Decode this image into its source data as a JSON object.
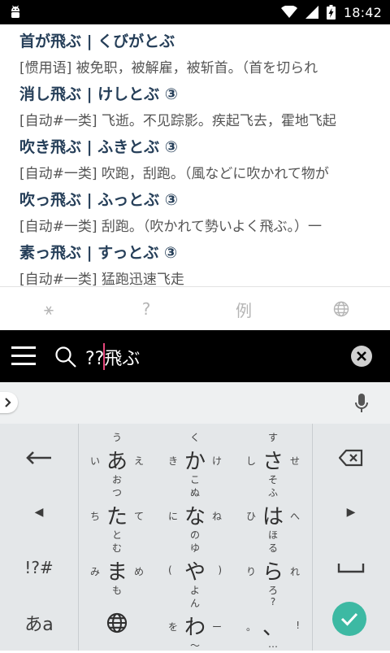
{
  "status_bar": {
    "time": "18:42"
  },
  "results": [
    {
      "word": "首が飛ぶ | くびがとぶ",
      "def": "[惯用语] 被免职，被解雇，被斩首。（首を切られ"
    },
    {
      "word": "消し飛ぶ | けしとぶ ③",
      "def": "[自动#一类] 飞逝。不见踪影。疾起飞去，霍地飞起"
    },
    {
      "word": "吹き飛ぶ | ふきとぶ ③",
      "def": "[自动#一类] 吹跑，刮跑。（風などに吹かれて物が"
    },
    {
      "word": "吹っ飛ぶ | ふっとぶ ③",
      "def": "[自动#一类] 刮跑。（吹かれて勢いよく飛ぶ。）一"
    },
    {
      "word": "素っ飛ぶ | すっとぶ ③",
      "def": "[自动#一类] 猛跑迅速飞走"
    }
  ],
  "tabs": [
    {
      "label": "⚹",
      "icon": "asterisk-icon"
    },
    {
      "label": "?",
      "icon": "question-icon"
    },
    {
      "label": "例",
      "icon": "example-icon"
    },
    {
      "label": "",
      "icon": "globe-icon"
    }
  ],
  "search": {
    "query": "??飛ぶ"
  },
  "keyboard": {
    "left_keys": [
      "⟵",
      "◀",
      "!?#",
      "あa"
    ],
    "right_keys": [
      "⌫",
      "▶",
      "⎵",
      "✓"
    ],
    "kana": [
      {
        "c": "あ",
        "u": "う",
        "d": "お",
        "l": "い",
        "r": "え"
      },
      {
        "c": "か",
        "u": "く",
        "d": "こ",
        "l": "き",
        "r": "け"
      },
      {
        "c": "さ",
        "u": "す",
        "d": "そ",
        "l": "し",
        "r": "せ"
      },
      {
        "c": "た",
        "u": "つ",
        "d": "と",
        "l": "ち",
        "r": "て"
      },
      {
        "c": "な",
        "u": "ぬ",
        "d": "の",
        "l": "に",
        "r": "ね"
      },
      {
        "c": "は",
        "u": "ふ",
        "d": "ほ",
        "l": "ひ",
        "r": "へ"
      },
      {
        "c": "ま",
        "u": "む",
        "d": "も",
        "l": "み",
        "r": "め"
      },
      {
        "c": "や",
        "u": "ゆ",
        "d": "よ",
        "l": "(",
        "r": ")"
      },
      {
        "c": "ら",
        "u": "る",
        "d": "ろ",
        "l": "り",
        "r": "れ"
      },
      {
        "c": "",
        "u": "",
        "d": "",
        "l": "",
        "r": ""
      },
      {
        "c": "わ",
        "u": "ん",
        "d": "〜",
        "l": "を",
        "r": "ー"
      },
      {
        "c": "、",
        "u": "?",
        "d": "…",
        "l": "。",
        "r": "!"
      }
    ]
  },
  "colors": {
    "accent": "#e4457a",
    "enter": "#3db9a3",
    "word": "#263f59"
  }
}
